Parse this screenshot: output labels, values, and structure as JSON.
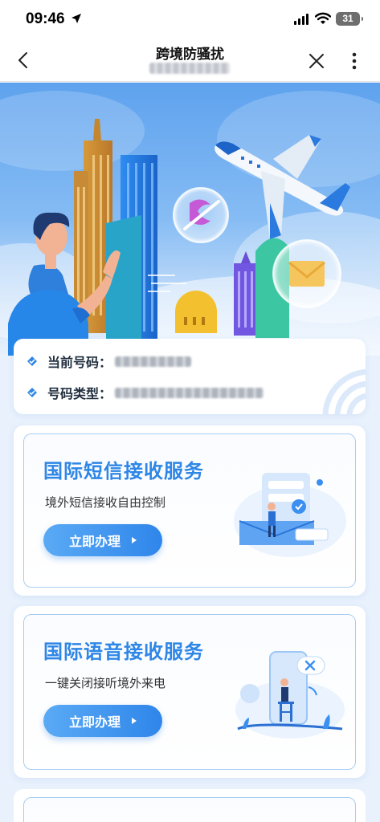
{
  "status_bar": {
    "time": "09:46",
    "battery": "31"
  },
  "nav": {
    "title": "跨境防骚扰"
  },
  "info": {
    "phone_label": "当前号码：",
    "type_label": "号码类型："
  },
  "services": [
    {
      "title": "国际短信接收服务",
      "desc": "境外短信接收自由控制",
      "button": "立即办理"
    },
    {
      "title": "国际语音接收服务",
      "desc": "一键关闭接听境外来电",
      "button": "立即办理"
    }
  ],
  "colors": {
    "accent": "#2e86e6",
    "card_border": "#a9cdf3",
    "background": "#e8f1fc"
  }
}
